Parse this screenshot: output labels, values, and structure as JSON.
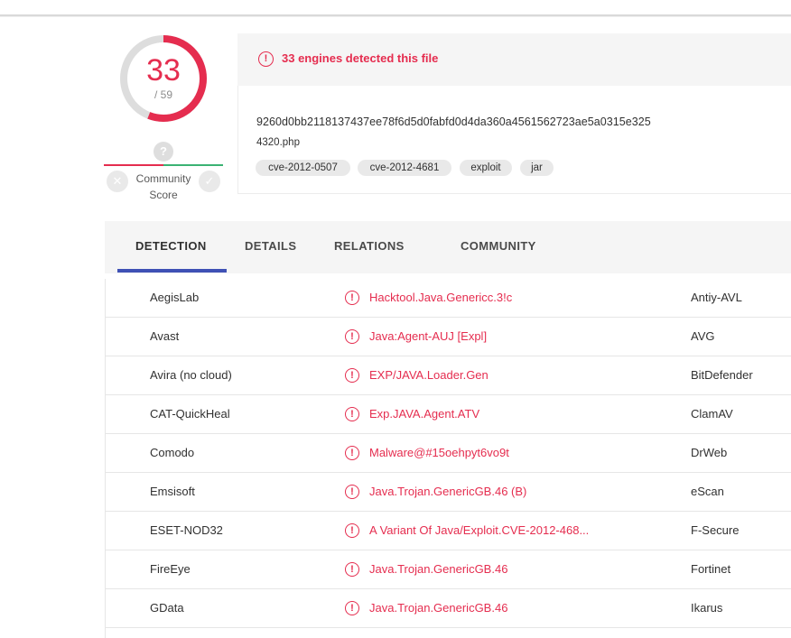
{
  "score": {
    "detected": "33",
    "total": "/ 59",
    "detected_ratio": 0.5593,
    "ring_color": "#e52d4f"
  },
  "community": {
    "question_icon_glyph": "?",
    "label_line1": "Community",
    "label_line2": "Score",
    "negative_color": "#e52d4f",
    "positive_color": "#3bb273"
  },
  "header": {
    "detected_text": "33 engines detected this file",
    "hash": "9260d0bb2118137437ee78f6d5d0fabfd0d4da360a4561562723ae5a0315e325",
    "filename": "4320.php",
    "tags": [
      "cve-2012-0507",
      "cve-2012-4681",
      "exploit",
      "jar"
    ]
  },
  "tabs": [
    "DETECTION",
    "DETAILS",
    "RELATIONS",
    "COMMUNITY"
  ],
  "accent_color": "#3f51b5",
  "rows": [
    {
      "engine": "AegisLab",
      "result": "Hacktool.Java.Genericc.3!c",
      "engine2": "Antiy-AVL"
    },
    {
      "engine": "Avast",
      "result": "Java:Agent-AUJ [Expl]",
      "engine2": "AVG"
    },
    {
      "engine": "Avira (no cloud)",
      "result": "EXP/JAVA.Loader.Gen",
      "engine2": "BitDefender"
    },
    {
      "engine": "CAT-QuickHeal",
      "result": "Exp.JAVA.Agent.ATV",
      "engine2": "ClamAV"
    },
    {
      "engine": "Comodo",
      "result": "Malware@#15oehpyt6vo9t",
      "engine2": "DrWeb"
    },
    {
      "engine": "Emsisoft",
      "result": "Java.Trojan.GenericGB.46 (B)",
      "engine2": "eScan"
    },
    {
      "engine": "ESET-NOD32",
      "result": "A Variant Of Java/Exploit.CVE-2012-468...",
      "engine2": "F-Secure"
    },
    {
      "engine": "FireEye",
      "result": "Java.Trojan.GenericGB.46",
      "engine2": "Fortinet"
    },
    {
      "engine": "GData",
      "result": "Java.Trojan.GenericGB.46",
      "engine2": "Ikarus"
    }
  ]
}
